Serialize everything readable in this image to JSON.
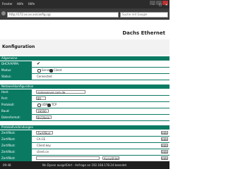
{
  "browser": {
    "menu": [
      "Fenster",
      "Hilfe",
      "Hilfe"
    ],
    "window_controls": [
      "–",
      "□",
      "✕"
    ],
    "url": "http://172.xx.xx.xx/config.cgi",
    "search_placeholder": "Suche mit Google"
  },
  "page": {
    "brand": "Dachs Ethernet",
    "title": "Konfiguration"
  },
  "sections": {
    "s1": "Allgemeine",
    "s2": "Netzwerkkonfiguration",
    "s3": "Protokollverbindungen"
  },
  "rows": {
    "r1_label": "DHCP/APIPA:",
    "r1_check": "✔",
    "r2_label": "Modus:",
    "r2_opt1": "Server",
    "r2_opt2": "Client",
    "r3_label": "Status:",
    "r3_value": "Connected",
    "r4_label": "Host:",
    "r4_value": "someserver.com.de",
    "r5_label": "Port:",
    "r5_value": "80",
    "r6_label": "Protokoll:",
    "r6_opt1": "UDP",
    "r6_opt2": "TCP",
    "r7_label": "Baud:",
    "r7_value": "19200",
    "r8_label": "Datenformat:",
    "r8_value": "8n1/kein",
    "r9_label": "Zertifikat:",
    "r9_value": "Zertifikat",
    "r10_label": "Zertifikat:",
    "r10_value": "CA.CE",
    "r11_label": "Zertifikat:",
    "r11_value": "Client.key",
    "r12_label": "Zertifikat:",
    "r12_value": "client.ce",
    "r13_label": "Zertifikat:",
    "r13_value": "Auswählen",
    "info": "Info"
  },
  "status": {
    "time": "09:48",
    "message": "Nn Dyson ausgeführt · Anfrage an 192.168.178.24 beendet"
  }
}
